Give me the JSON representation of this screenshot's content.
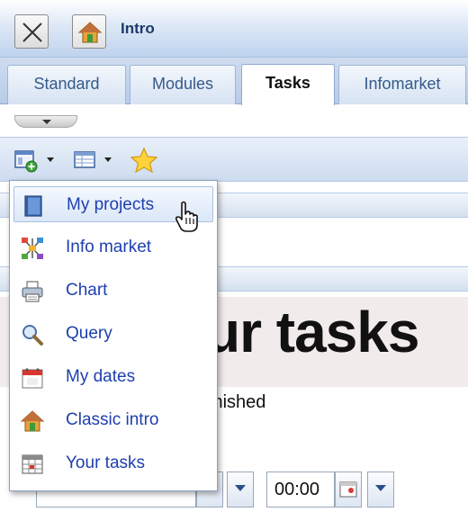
{
  "window": {
    "title": "Intro"
  },
  "tabs": [
    {
      "label": "Standard",
      "active": false
    },
    {
      "label": "Modules",
      "active": false
    },
    {
      "label": "Tasks",
      "active": true
    },
    {
      "label": "Infomarket",
      "active": false
    }
  ],
  "menu": {
    "items": [
      {
        "label": "My projects",
        "icon": "book-icon",
        "hovered": true
      },
      {
        "label": "Info market",
        "icon": "network-icon"
      },
      {
        "label": "Chart",
        "icon": "printer-icon"
      },
      {
        "label": "Query",
        "icon": "magnifier-icon"
      },
      {
        "label": "My dates",
        "icon": "calendar-icon"
      },
      {
        "label": "Classic intro",
        "icon": "house-icon"
      },
      {
        "label": "Your tasks",
        "icon": "task-grid-icon"
      }
    ]
  },
  "content": {
    "heading": "ur tasks",
    "status_text": "inished",
    "date_value": "",
    "time_value": "00:00"
  },
  "colors": {
    "accent": "#1e3fae",
    "title": "#1d3a6b",
    "tab_text": "#355a8a"
  }
}
